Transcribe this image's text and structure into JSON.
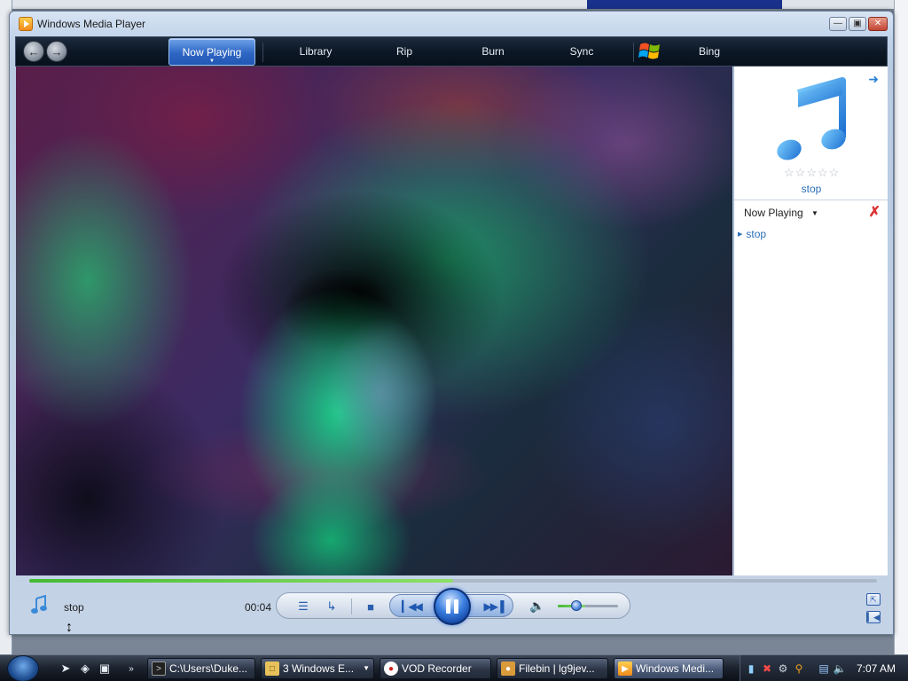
{
  "window": {
    "title": "Windows Media Player",
    "minimize_icon": "minimize-icon",
    "maximize_icon": "maximize-icon",
    "close_icon": "close-icon"
  },
  "nav": {
    "back_icon": "back-arrow-icon",
    "forward_icon": "forward-arrow-icon",
    "tabs": [
      {
        "label": "Now Playing",
        "active": true
      },
      {
        "label": "Library",
        "active": false
      },
      {
        "label": "Rip",
        "active": false
      },
      {
        "label": "Burn",
        "active": false
      },
      {
        "label": "Sync",
        "active": false
      },
      {
        "label": "Bing",
        "active": false
      }
    ]
  },
  "side_panel": {
    "album_title": "stop",
    "rating_stars": 0,
    "rating_max": 5,
    "now_playing_label": "Now Playing",
    "playlist": [
      "stop"
    ]
  },
  "player": {
    "track_name": "stop",
    "time": "00:04",
    "progress": 0.5,
    "volume": 0.45,
    "state": "playing"
  },
  "taskbar": {
    "items": [
      {
        "label": "C:\\Users\\Duke...",
        "active": false,
        "icon": "cmd-icon"
      },
      {
        "label": "3 Windows E...",
        "active": false,
        "icon": "folder-icon"
      },
      {
        "label": "VOD Recorder",
        "active": false,
        "icon": "record-icon"
      },
      {
        "label": "Filebin | lg9jev...",
        "active": false,
        "icon": "firefox-icon"
      },
      {
        "label": "Windows Medi...",
        "active": true,
        "icon": "media-player-icon"
      }
    ],
    "clock": "7:07 AM"
  },
  "colors": {
    "accent": "#2e66c4",
    "seek_fill": "#44bb33",
    "link": "#2a6fb8"
  }
}
